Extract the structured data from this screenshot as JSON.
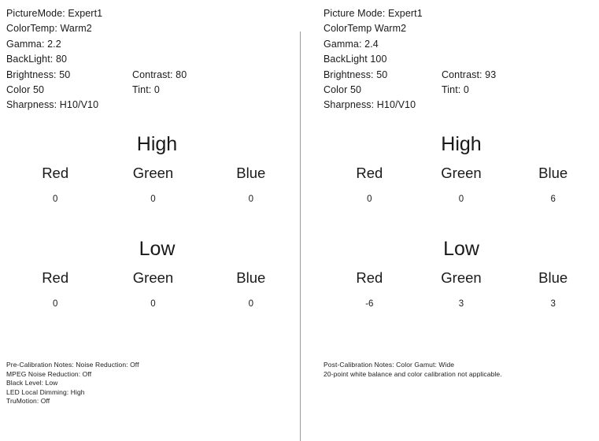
{
  "layout": {
    "divider_color": "#9a9a9a"
  },
  "left_panel": {
    "name": "pre-calibration",
    "settings": {
      "picture_mode": "PictureMode: Expert1",
      "color_temp": "ColorTemp: Warm2",
      "gamma": "Gamma: 2.2",
      "backlight": "BackLight: 80",
      "brightness": "Brightness: 50",
      "contrast": "Contrast: 80",
      "color": "Color  50",
      "tint": "Tint: 0",
      "sharpness": "Sharpness: H10/V10"
    },
    "high": {
      "title": "High",
      "labels": [
        "Red",
        "Green",
        "Blue"
      ],
      "values": [
        "0",
        "0",
        "0"
      ]
    },
    "low": {
      "title": "Low",
      "labels": [
        "Red",
        "Green",
        "Blue"
      ],
      "values": [
        "0",
        "0",
        "0"
      ]
    },
    "notes": [
      "Pre-Calibration Notes: Noise Reduction: Off",
      "MPEG Noise Reduction: Off",
      "Black Level: Low",
      "LED Local Dimming: High",
      "TruMotion: Off"
    ]
  },
  "right_panel": {
    "name": "post-calibration",
    "settings": {
      "picture_mode": "Picture Mode: Expert1",
      "color_temp": "ColorTemp  Warm2",
      "gamma": "Gamma: 2.4",
      "backlight": "BackLight  100",
      "brightness": "Brightness: 50",
      "contrast": "Contrast: 93",
      "color": "Color  50",
      "tint": "Tint: 0",
      "sharpness": "Sharpness: H10/V10"
    },
    "high": {
      "title": "High",
      "labels": [
        "Red",
        "Green",
        "Blue"
      ],
      "values": [
        "0",
        "0",
        "6"
      ]
    },
    "low": {
      "title": "Low",
      "labels": [
        "Red",
        "Green",
        "Blue"
      ],
      "values": [
        "-6",
        "3",
        "3"
      ]
    },
    "notes": [
      "Post-Calibration Notes: Color Gamut: Wide",
      "20-point white balance and color calibration not applicable."
    ]
  }
}
